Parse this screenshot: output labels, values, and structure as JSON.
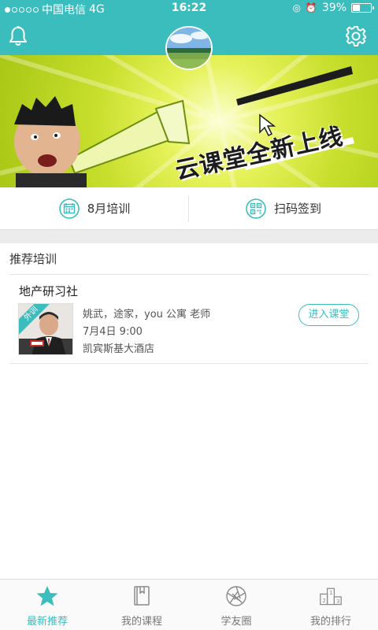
{
  "status_bar": {
    "carrier": "中国电信",
    "network": "4G",
    "time": "16:22",
    "battery": "39%",
    "battery_level": 0.39,
    "signal_bars": 1
  },
  "header": {
    "bell_icon": "bell-icon",
    "settings_icon": "gear-icon",
    "avatar_icon": "avatar"
  },
  "banner": {
    "headline": "云课堂全新上线",
    "page_count": 2,
    "active_page": 1
  },
  "actions": [
    {
      "label": "8月培训",
      "icon": "calendar-icon"
    },
    {
      "label": "扫码签到",
      "icon": "qr-code-icon"
    }
  ],
  "recommend": {
    "title": "推荐培训",
    "items": [
      {
        "title": "地产研习社",
        "tag": "外训",
        "teacher": "姚武，途家，you 公寓  老师",
        "date": "7月4日 9:00",
        "place": "凯宾斯基大酒店",
        "button": "进入课堂"
      }
    ]
  },
  "tabbar": {
    "tabs": [
      {
        "label": "最新推荐",
        "icon": "star-icon",
        "active": true
      },
      {
        "label": "我的课程",
        "icon": "book-icon",
        "active": false
      },
      {
        "label": "学友圈",
        "icon": "aperture-icon",
        "active": false
      },
      {
        "label": "我的排行",
        "icon": "podium-icon",
        "active": false
      }
    ]
  },
  "colors": {
    "accent": "#3bbdbe",
    "banner_green": "#b7d220"
  }
}
